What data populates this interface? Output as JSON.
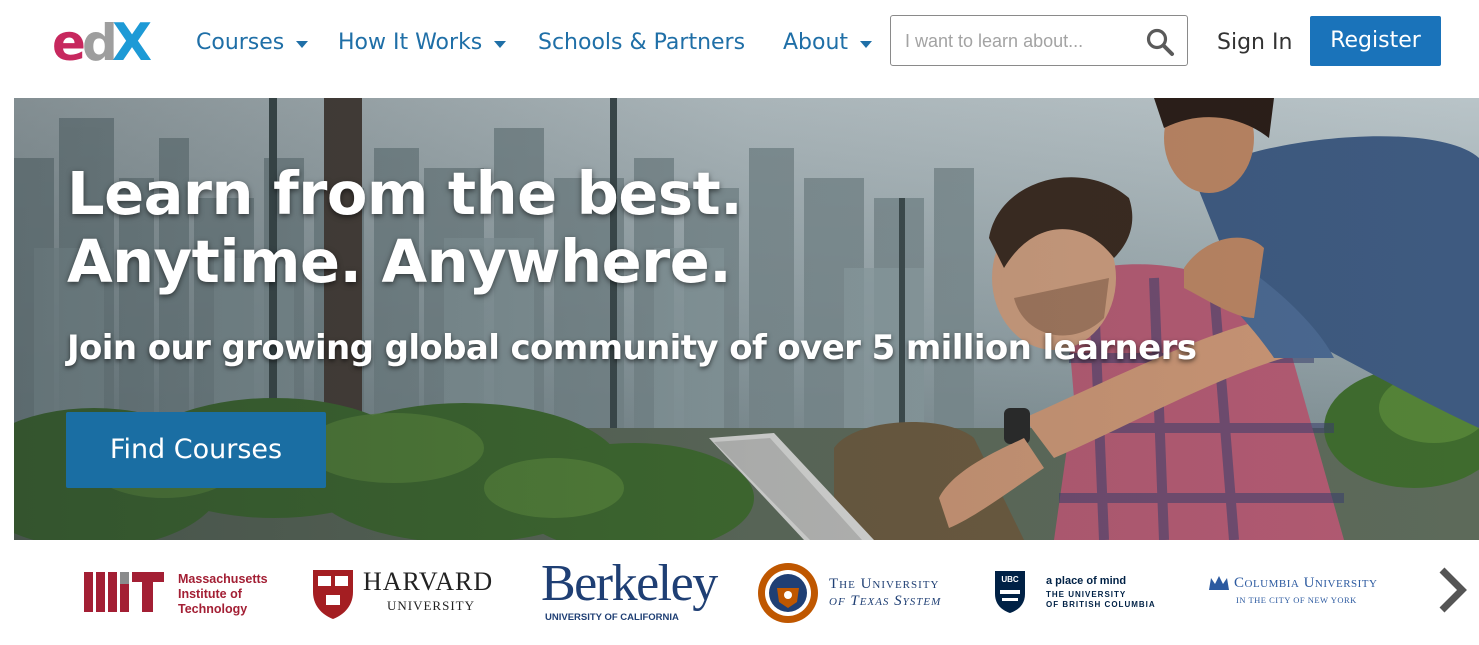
{
  "brand": {
    "logo_text": "edX",
    "colors": {
      "logo_e": "#c7285e",
      "logo_d": "#9e9e9e",
      "logo_x": "#1d9ad6",
      "nav": "#1f6fa7",
      "register_bg": "#1a73ba",
      "find_bg": "#1a6ea3",
      "mit_red": "#a31f34",
      "harvard_red": "#a41e22",
      "berkeley_blue": "#1f3f74",
      "texas_orange": "#bf5700",
      "ubc_blue": "#002145",
      "columbia_blue": "#2c5aa0"
    }
  },
  "nav": {
    "courses": "Courses",
    "how_it_works": "How It Works",
    "schools_partners": "Schools & Partners",
    "about": "About"
  },
  "search": {
    "placeholder": "I want to learn about...",
    "value": "",
    "icon": "search-icon"
  },
  "auth": {
    "sign_in": "Sign In",
    "register": "Register"
  },
  "hero": {
    "title_line1": "Learn from the best.",
    "title_line2": "Anytime. Anywhere.",
    "subtitle": "Join our growing global community of over 5 million learners",
    "cta": "Find Courses"
  },
  "partners": {
    "mit": {
      "mark": "MIT",
      "line1": "Massachusetts",
      "line2": "Institute of",
      "line3": "Technology"
    },
    "harvard": {
      "shield": "VE RI TAS",
      "line1": "HARVARD",
      "line2": "UNIVERSITY"
    },
    "berkeley": {
      "line1": "Berkeley",
      "line2": "UNIVERSITY OF CALIFORNIA"
    },
    "texas": {
      "line1": "The University",
      "line2": "of Texas System"
    },
    "ubc": {
      "badge": "UBC",
      "line1": "a place of mind",
      "line2": "THE UNIVERSITY",
      "line3": "OF BRITISH COLUMBIA"
    },
    "columbia": {
      "line1": "Columbia University",
      "line2": "IN THE CITY OF NEW YORK"
    },
    "next_icon": "chevron-right-icon"
  }
}
